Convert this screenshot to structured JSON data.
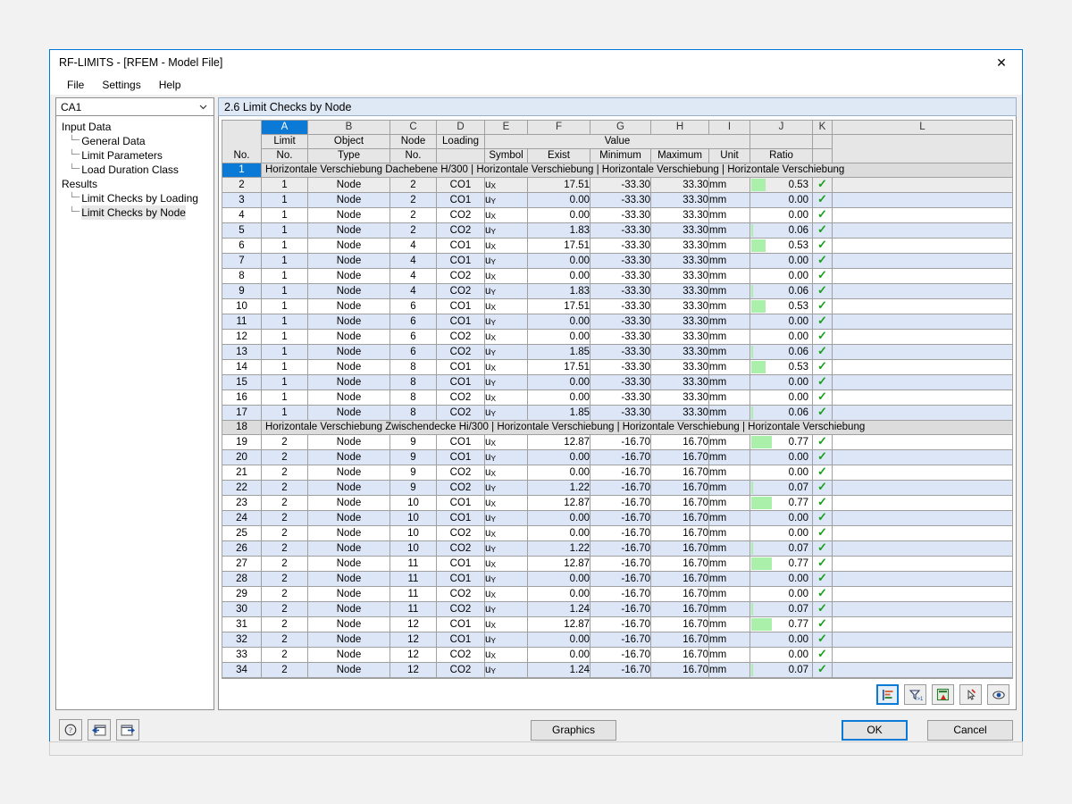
{
  "window": {
    "title": "RF-LIMITS - [RFEM - Model File]",
    "close_icon": "close-icon"
  },
  "menu": {
    "items": [
      "File",
      "Settings",
      "Help"
    ]
  },
  "sidebar": {
    "combo_value": "CA1",
    "caret_icon": "chevron-down-icon",
    "groups": [
      {
        "label": "Input Data",
        "children": [
          "General Data",
          "Limit Parameters",
          "Load Duration Class"
        ]
      },
      {
        "label": "Results",
        "children": [
          "Limit Checks by Loading",
          "Limit Checks by Node"
        ]
      }
    ],
    "selected": "Limit Checks by Node"
  },
  "panel": {
    "title": "2.6 Limit Checks by Node"
  },
  "table": {
    "column_letters": [
      "A",
      "B",
      "C",
      "D",
      "E",
      "F",
      "G",
      "H",
      "I",
      "J",
      "K",
      "L"
    ],
    "active_letter": "A",
    "rownum_header": "No.",
    "group_header": "Value",
    "headers_top": [
      "Limit",
      "Object",
      "Node",
      "Loading",
      "",
      "",
      "",
      "",
      "",
      "",
      "",
      ""
    ],
    "headers_bottom": [
      "No.",
      "Type",
      "No.",
      "",
      "Symbol",
      "Exist",
      "Minimum",
      "Maximum",
      "Unit",
      "Ratio",
      "",
      ""
    ],
    "check_icon": "check-mark-icon",
    "rows": [
      {
        "no": "1",
        "type": "section",
        "text": "Horizontale Verschiebung Dachebene H/300 | Horizontale Verschiebung | Horizontale Verschiebung | Horizontale Verschiebung",
        "selected": true
      },
      {
        "no": "2",
        "type": "data",
        "limit": "1",
        "object": "Node",
        "node": "2",
        "loading": "CO1",
        "symbol": "u",
        "symbol_sub": "X",
        "exist": "17.51",
        "min": "-33.30",
        "max": "33.30",
        "unit": "mm",
        "ratio": "0.53",
        "bar": 53,
        "check": true,
        "shade": "gray"
      },
      {
        "no": "3",
        "type": "data",
        "limit": "1",
        "object": "Node",
        "node": "2",
        "loading": "CO1",
        "symbol": "u",
        "symbol_sub": "Y",
        "exist": "0.00",
        "min": "-33.30",
        "max": "33.30",
        "unit": "mm",
        "ratio": "0.00",
        "bar": 0,
        "check": true,
        "shade": "odd"
      },
      {
        "no": "4",
        "type": "data",
        "limit": "1",
        "object": "Node",
        "node": "2",
        "loading": "CO2",
        "symbol": "u",
        "symbol_sub": "X",
        "exist": "0.00",
        "min": "-33.30",
        "max": "33.30",
        "unit": "mm",
        "ratio": "0.00",
        "bar": 0,
        "check": true,
        "shade": "even"
      },
      {
        "no": "5",
        "type": "data",
        "limit": "1",
        "object": "Node",
        "node": "2",
        "loading": "CO2",
        "symbol": "u",
        "symbol_sub": "Y",
        "exist": "1.83",
        "min": "-33.30",
        "max": "33.30",
        "unit": "mm",
        "ratio": "0.06",
        "bar": 6,
        "check": true,
        "shade": "odd"
      },
      {
        "no": "6",
        "type": "data",
        "limit": "1",
        "object": "Node",
        "node": "4",
        "loading": "CO1",
        "symbol": "u",
        "symbol_sub": "X",
        "exist": "17.51",
        "min": "-33.30",
        "max": "33.30",
        "unit": "mm",
        "ratio": "0.53",
        "bar": 53,
        "check": true,
        "shade": "even"
      },
      {
        "no": "7",
        "type": "data",
        "limit": "1",
        "object": "Node",
        "node": "4",
        "loading": "CO1",
        "symbol": "u",
        "symbol_sub": "Y",
        "exist": "0.00",
        "min": "-33.30",
        "max": "33.30",
        "unit": "mm",
        "ratio": "0.00",
        "bar": 0,
        "check": true,
        "shade": "odd"
      },
      {
        "no": "8",
        "type": "data",
        "limit": "1",
        "object": "Node",
        "node": "4",
        "loading": "CO2",
        "symbol": "u",
        "symbol_sub": "X",
        "exist": "0.00",
        "min": "-33.30",
        "max": "33.30",
        "unit": "mm",
        "ratio": "0.00",
        "bar": 0,
        "check": true,
        "shade": "even"
      },
      {
        "no": "9",
        "type": "data",
        "limit": "1",
        "object": "Node",
        "node": "4",
        "loading": "CO2",
        "symbol": "u",
        "symbol_sub": "Y",
        "exist": "1.83",
        "min": "-33.30",
        "max": "33.30",
        "unit": "mm",
        "ratio": "0.06",
        "bar": 6,
        "check": true,
        "shade": "odd"
      },
      {
        "no": "10",
        "type": "data",
        "limit": "1",
        "object": "Node",
        "node": "6",
        "loading": "CO1",
        "symbol": "u",
        "symbol_sub": "X",
        "exist": "17.51",
        "min": "-33.30",
        "max": "33.30",
        "unit": "mm",
        "ratio": "0.53",
        "bar": 53,
        "check": true,
        "shade": "even"
      },
      {
        "no": "11",
        "type": "data",
        "limit": "1",
        "object": "Node",
        "node": "6",
        "loading": "CO1",
        "symbol": "u",
        "symbol_sub": "Y",
        "exist": "0.00",
        "min": "-33.30",
        "max": "33.30",
        "unit": "mm",
        "ratio": "0.00",
        "bar": 0,
        "check": true,
        "shade": "odd"
      },
      {
        "no": "12",
        "type": "data",
        "limit": "1",
        "object": "Node",
        "node": "6",
        "loading": "CO2",
        "symbol": "u",
        "symbol_sub": "X",
        "exist": "0.00",
        "min": "-33.30",
        "max": "33.30",
        "unit": "mm",
        "ratio": "0.00",
        "bar": 0,
        "check": true,
        "shade": "even"
      },
      {
        "no": "13",
        "type": "data",
        "limit": "1",
        "object": "Node",
        "node": "6",
        "loading": "CO2",
        "symbol": "u",
        "symbol_sub": "Y",
        "exist": "1.85",
        "min": "-33.30",
        "max": "33.30",
        "unit": "mm",
        "ratio": "0.06",
        "bar": 6,
        "check": true,
        "shade": "odd"
      },
      {
        "no": "14",
        "type": "data",
        "limit": "1",
        "object": "Node",
        "node": "8",
        "loading": "CO1",
        "symbol": "u",
        "symbol_sub": "X",
        "exist": "17.51",
        "min": "-33.30",
        "max": "33.30",
        "unit": "mm",
        "ratio": "0.53",
        "bar": 53,
        "check": true,
        "shade": "even"
      },
      {
        "no": "15",
        "type": "data",
        "limit": "1",
        "object": "Node",
        "node": "8",
        "loading": "CO1",
        "symbol": "u",
        "symbol_sub": "Y",
        "exist": "0.00",
        "min": "-33.30",
        "max": "33.30",
        "unit": "mm",
        "ratio": "0.00",
        "bar": 0,
        "check": true,
        "shade": "odd"
      },
      {
        "no": "16",
        "type": "data",
        "limit": "1",
        "object": "Node",
        "node": "8",
        "loading": "CO2",
        "symbol": "u",
        "symbol_sub": "X",
        "exist": "0.00",
        "min": "-33.30",
        "max": "33.30",
        "unit": "mm",
        "ratio": "0.00",
        "bar": 0,
        "check": true,
        "shade": "even"
      },
      {
        "no": "17",
        "type": "data",
        "limit": "1",
        "object": "Node",
        "node": "8",
        "loading": "CO2",
        "symbol": "u",
        "symbol_sub": "Y",
        "exist": "1.85",
        "min": "-33.30",
        "max": "33.30",
        "unit": "mm",
        "ratio": "0.06",
        "bar": 6,
        "check": true,
        "shade": "odd"
      },
      {
        "no": "18",
        "type": "section",
        "text": "Horizontale Verschiebung Zwischendecke Hi/300 | Horizontale Verschiebung | Horizontale Verschiebung | Horizontale Verschiebung",
        "selected": false
      },
      {
        "no": "19",
        "type": "data",
        "limit": "2",
        "object": "Node",
        "node": "9",
        "loading": "CO1",
        "symbol": "u",
        "symbol_sub": "X",
        "exist": "12.87",
        "min": "-16.70",
        "max": "16.70",
        "unit": "mm",
        "ratio": "0.77",
        "bar": 77,
        "check": true,
        "shade": "even"
      },
      {
        "no": "20",
        "type": "data",
        "limit": "2",
        "object": "Node",
        "node": "9",
        "loading": "CO1",
        "symbol": "u",
        "symbol_sub": "Y",
        "exist": "0.00",
        "min": "-16.70",
        "max": "16.70",
        "unit": "mm",
        "ratio": "0.00",
        "bar": 0,
        "check": true,
        "shade": "odd"
      },
      {
        "no": "21",
        "type": "data",
        "limit": "2",
        "object": "Node",
        "node": "9",
        "loading": "CO2",
        "symbol": "u",
        "symbol_sub": "X",
        "exist": "0.00",
        "min": "-16.70",
        "max": "16.70",
        "unit": "mm",
        "ratio": "0.00",
        "bar": 0,
        "check": true,
        "shade": "even"
      },
      {
        "no": "22",
        "type": "data",
        "limit": "2",
        "object": "Node",
        "node": "9",
        "loading": "CO2",
        "symbol": "u",
        "symbol_sub": "Y",
        "exist": "1.22",
        "min": "-16.70",
        "max": "16.70",
        "unit": "mm",
        "ratio": "0.07",
        "bar": 7,
        "check": true,
        "shade": "odd"
      },
      {
        "no": "23",
        "type": "data",
        "limit": "2",
        "object": "Node",
        "node": "10",
        "loading": "CO1",
        "symbol": "u",
        "symbol_sub": "X",
        "exist": "12.87",
        "min": "-16.70",
        "max": "16.70",
        "unit": "mm",
        "ratio": "0.77",
        "bar": 77,
        "check": true,
        "shade": "even"
      },
      {
        "no": "24",
        "type": "data",
        "limit": "2",
        "object": "Node",
        "node": "10",
        "loading": "CO1",
        "symbol": "u",
        "symbol_sub": "Y",
        "exist": "0.00",
        "min": "-16.70",
        "max": "16.70",
        "unit": "mm",
        "ratio": "0.00",
        "bar": 0,
        "check": true,
        "shade": "odd"
      },
      {
        "no": "25",
        "type": "data",
        "limit": "2",
        "object": "Node",
        "node": "10",
        "loading": "CO2",
        "symbol": "u",
        "symbol_sub": "X",
        "exist": "0.00",
        "min": "-16.70",
        "max": "16.70",
        "unit": "mm",
        "ratio": "0.00",
        "bar": 0,
        "check": true,
        "shade": "even"
      },
      {
        "no": "26",
        "type": "data",
        "limit": "2",
        "object": "Node",
        "node": "10",
        "loading": "CO2",
        "symbol": "u",
        "symbol_sub": "Y",
        "exist": "1.22",
        "min": "-16.70",
        "max": "16.70",
        "unit": "mm",
        "ratio": "0.07",
        "bar": 7,
        "check": true,
        "shade": "odd"
      },
      {
        "no": "27",
        "type": "data",
        "limit": "2",
        "object": "Node",
        "node": "11",
        "loading": "CO1",
        "symbol": "u",
        "symbol_sub": "X",
        "exist": "12.87",
        "min": "-16.70",
        "max": "16.70",
        "unit": "mm",
        "ratio": "0.77",
        "bar": 77,
        "check": true,
        "shade": "even"
      },
      {
        "no": "28",
        "type": "data",
        "limit": "2",
        "object": "Node",
        "node": "11",
        "loading": "CO1",
        "symbol": "u",
        "symbol_sub": "Y",
        "exist": "0.00",
        "min": "-16.70",
        "max": "16.70",
        "unit": "mm",
        "ratio": "0.00",
        "bar": 0,
        "check": true,
        "shade": "odd"
      },
      {
        "no": "29",
        "type": "data",
        "limit": "2",
        "object": "Node",
        "node": "11",
        "loading": "CO2",
        "symbol": "u",
        "symbol_sub": "X",
        "exist": "0.00",
        "min": "-16.70",
        "max": "16.70",
        "unit": "mm",
        "ratio": "0.00",
        "bar": 0,
        "check": true,
        "shade": "even"
      },
      {
        "no": "30",
        "type": "data",
        "limit": "2",
        "object": "Node",
        "node": "11",
        "loading": "CO2",
        "symbol": "u",
        "symbol_sub": "Y",
        "exist": "1.24",
        "min": "-16.70",
        "max": "16.70",
        "unit": "mm",
        "ratio": "0.07",
        "bar": 7,
        "check": true,
        "shade": "odd"
      },
      {
        "no": "31",
        "type": "data",
        "limit": "2",
        "object": "Node",
        "node": "12",
        "loading": "CO1",
        "symbol": "u",
        "symbol_sub": "X",
        "exist": "12.87",
        "min": "-16.70",
        "max": "16.70",
        "unit": "mm",
        "ratio": "0.77",
        "bar": 77,
        "check": true,
        "shade": "even"
      },
      {
        "no": "32",
        "type": "data",
        "limit": "2",
        "object": "Node",
        "node": "12",
        "loading": "CO1",
        "symbol": "u",
        "symbol_sub": "Y",
        "exist": "0.00",
        "min": "-16.70",
        "max": "16.70",
        "unit": "mm",
        "ratio": "0.00",
        "bar": 0,
        "check": true,
        "shade": "odd"
      },
      {
        "no": "33",
        "type": "data",
        "limit": "2",
        "object": "Node",
        "node": "12",
        "loading": "CO2",
        "symbol": "u",
        "symbol_sub": "X",
        "exist": "0.00",
        "min": "-16.70",
        "max": "16.70",
        "unit": "mm",
        "ratio": "0.00",
        "bar": 0,
        "check": true,
        "shade": "even"
      },
      {
        "no": "34",
        "type": "data",
        "limit": "2",
        "object": "Node",
        "node": "12",
        "loading": "CO2",
        "symbol": "u",
        "symbol_sub": "Y",
        "exist": "1.24",
        "min": "-16.70",
        "max": "16.70",
        "unit": "mm",
        "ratio": "0.07",
        "bar": 7,
        "check": true,
        "shade": "odd"
      }
    ]
  },
  "grid_toolbar": {
    "buttons": [
      {
        "icon": "result-bars-icon",
        "pressed": true
      },
      {
        "icon": "filter-icon"
      },
      {
        "icon": "export-excel-icon"
      },
      {
        "icon": "select-pin-icon"
      },
      {
        "icon": "view-eye-icon"
      }
    ]
  },
  "bottom": {
    "help_icon": "help-question-icon",
    "prev_icon": "previous-arrow-icon",
    "next_icon": "next-arrow-icon",
    "graphics_label": "Graphics",
    "ok_label": "OK",
    "cancel_label": "Cancel"
  },
  "colors": {
    "accent": "#0b7ad6",
    "row_alt": "#dce6f7",
    "bar_green": "#aaf0aa",
    "check_green": "#17a01a",
    "panel_header": "#dfe8f5"
  }
}
